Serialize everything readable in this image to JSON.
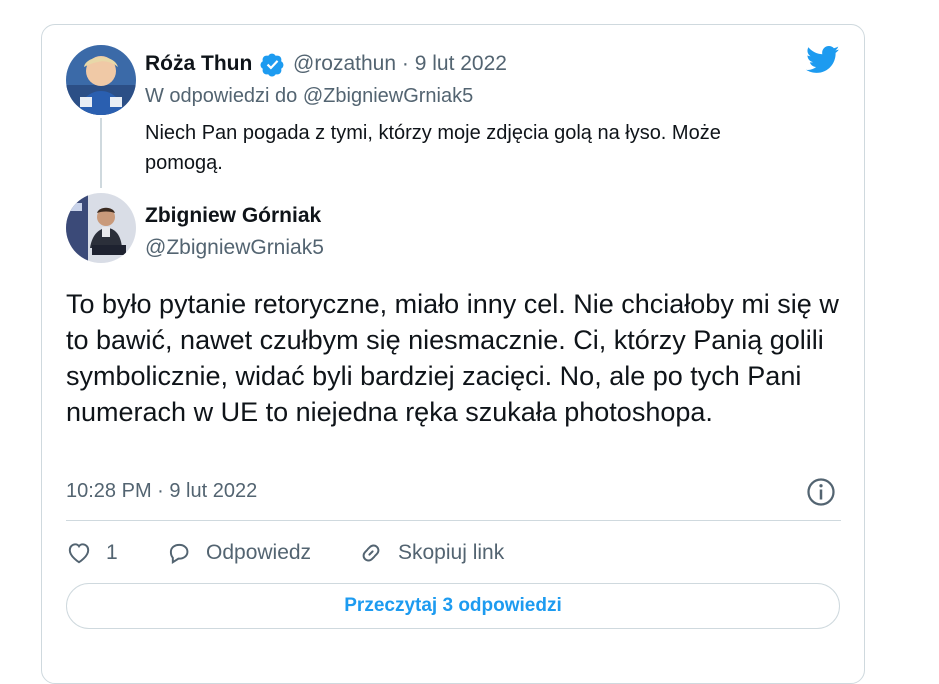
{
  "reply_tweet": {
    "display_name": "Róża Thun",
    "handle": "@rozathun",
    "separator": " · ",
    "date": "9 lut 2022",
    "reply_context": "W odpowiedzi do @ZbigniewGrniak5",
    "text": "Niech Pan pogada z tymi, którzy moje zdjęcia golą na łyso. Może pomogą."
  },
  "main_tweet": {
    "display_name": "Zbigniew Górniak",
    "handle": "@ZbigniewGrniak5",
    "text": "To było pytanie retoryczne, miało inny cel. Nie chciałoby mi się w to bawić, nawet czułbym się niesmacznie. Ci, którzy Panią golili symbolicznie, widać byli bardziej zacięci. No, ale po tych Pani numerach w UE to niejedna ręka szukała photoshopa.",
    "timestamp": "10:28 PM · 9 lut 2022"
  },
  "actions": {
    "like_count": "1",
    "reply_label": "Odpowiedz",
    "copy_link_label": "Skopiuj link"
  },
  "read_replies_label": "Przeczytaj 3 odpowiedzi",
  "colors": {
    "twitter_blue": "#1d9bf0",
    "secondary_text": "#536471",
    "border": "#cfd9de"
  },
  "icons": [
    "twitter-bird-icon",
    "verified-badge-icon",
    "info-icon",
    "heart-icon",
    "reply-bubble-icon",
    "link-icon"
  ]
}
